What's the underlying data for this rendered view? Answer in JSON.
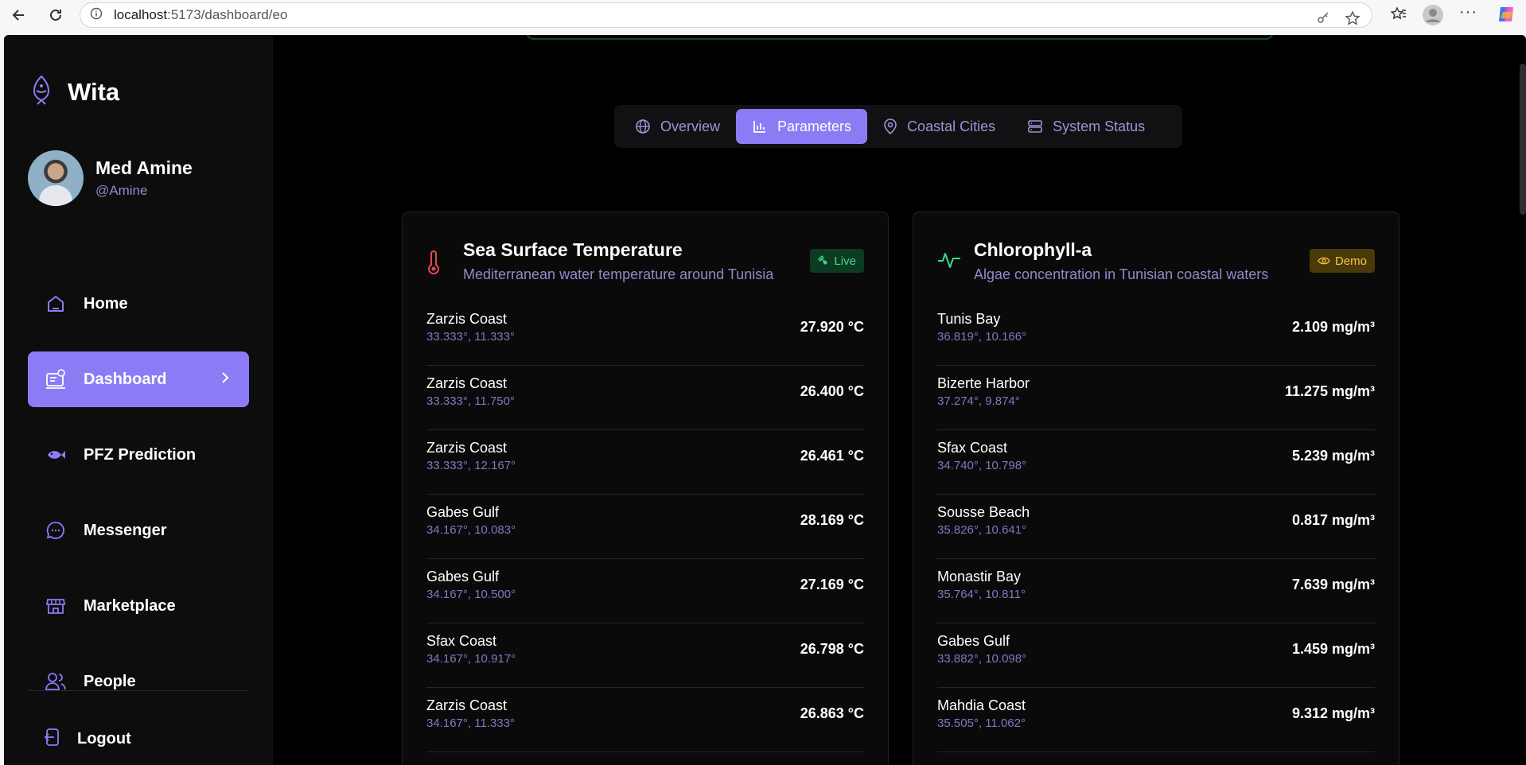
{
  "browser": {
    "url_host": "localhost",
    "url_path": ":5173/dashboard/eo"
  },
  "brand": {
    "name": "Wita"
  },
  "profile": {
    "name": "Med Amine",
    "handle": "@Amine"
  },
  "menu": {
    "items": [
      {
        "label": "Home",
        "icon": "home-icon"
      },
      {
        "label": "Dashboard",
        "icon": "dashboard-icon"
      },
      {
        "label": "PFZ Prediction",
        "icon": "fish-icon"
      },
      {
        "label": "Messenger",
        "icon": "chat-icon"
      },
      {
        "label": "Marketplace",
        "icon": "store-icon"
      },
      {
        "label": "People",
        "icon": "people-icon"
      }
    ],
    "logout": "Logout"
  },
  "tabs": [
    {
      "label": "Overview",
      "icon": "globe-icon"
    },
    {
      "label": "Parameters",
      "icon": "bar-chart-icon"
    },
    {
      "label": "Coastal Cities",
      "icon": "map-pin-icon"
    },
    {
      "label": "System Status",
      "icon": "server-icon"
    }
  ],
  "colors": {
    "accent": "#8b7cf6",
    "live": "#3ddc84",
    "demo": "#f5c542",
    "temperature": "#e5484d",
    "chlorophyll": "#3ddc84"
  },
  "sst": {
    "title": "Sea Surface Temperature",
    "subtitle": "Mediterranean water temperature around Tunisia",
    "badge": "Live",
    "rows": [
      {
        "name": "Zarzis Coast",
        "coord": "33.333°, 11.333°",
        "value": "27.920 °C"
      },
      {
        "name": "Zarzis Coast",
        "coord": "33.333°, 11.750°",
        "value": "26.400 °C"
      },
      {
        "name": "Zarzis Coast",
        "coord": "33.333°, 12.167°",
        "value": "26.461 °C"
      },
      {
        "name": "Gabes Gulf",
        "coord": "34.167°, 10.083°",
        "value": "28.169 °C"
      },
      {
        "name": "Gabes Gulf",
        "coord": "34.167°, 10.500°",
        "value": "27.169 °C"
      },
      {
        "name": "Sfax Coast",
        "coord": "34.167°, 10.917°",
        "value": "26.798 °C"
      },
      {
        "name": "Zarzis Coast",
        "coord": "34.167°, 11.333°",
        "value": "26.863 °C"
      }
    ]
  },
  "chl": {
    "title": "Chlorophyll-a",
    "subtitle": "Algae concentration in Tunisian coastal waters",
    "badge": "Demo",
    "rows": [
      {
        "name": "Tunis Bay",
        "coord": "36.819°, 10.166°",
        "value": "2.109 mg/m³"
      },
      {
        "name": "Bizerte Harbor",
        "coord": "37.274°, 9.874°",
        "value": "11.275 mg/m³"
      },
      {
        "name": "Sfax Coast",
        "coord": "34.740°, 10.798°",
        "value": "5.239 mg/m³"
      },
      {
        "name": "Sousse Beach",
        "coord": "35.826°, 10.641°",
        "value": "0.817 mg/m³"
      },
      {
        "name": "Monastir Bay",
        "coord": "35.764°, 10.811°",
        "value": "7.639 mg/m³"
      },
      {
        "name": "Gabes Gulf",
        "coord": "33.882°, 10.098°",
        "value": "1.459 mg/m³"
      },
      {
        "name": "Mahdia Coast",
        "coord": "35.505°, 11.062°",
        "value": "9.312 mg/m³"
      }
    ]
  }
}
